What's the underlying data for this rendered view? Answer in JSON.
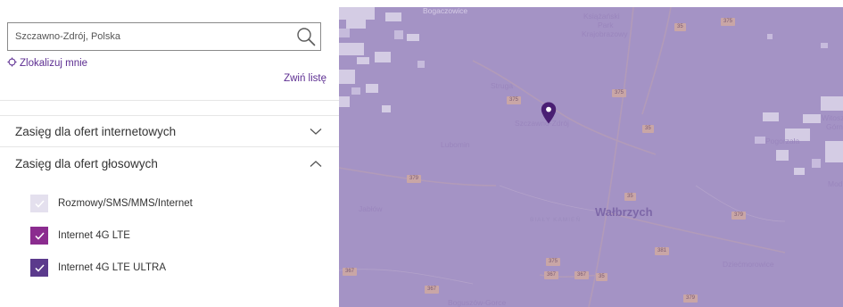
{
  "search": {
    "value": "Szczawno-Zdrój, Polska",
    "icon": "search-icon"
  },
  "locate": {
    "label": "Zlokalizuj mnie",
    "icon": "crosshair-icon"
  },
  "collapse": {
    "label": "Zwiń listę"
  },
  "accordion": {
    "internet": {
      "label": "Zasięg dla ofert internetowych",
      "icon": "chevron-down-icon"
    },
    "voice": {
      "label": "Zasięg dla ofert głosowych",
      "icon": "chevron-up-icon"
    }
  },
  "legend": [
    {
      "label": "Rozmowy/SMS/MMS/Internet",
      "color": "#e4e0ee",
      "checked": true
    },
    {
      "label": "Internet 4G LTE",
      "color": "#8b2c8f",
      "checked": true
    },
    {
      "label": "Internet 4G LTE ULTRA",
      "color": "#5b3a8c",
      "checked": true
    }
  ],
  "map": {
    "overlay_color": "#a493c5",
    "labels": {
      "bogaczowice": "Bogaczowice",
      "ksiazanski": "Książański",
      "park": "Park",
      "krajobrazowy": "Krajobrazowy",
      "struga": "Struga",
      "szczawno": "Szczawno-Zdrój",
      "lubomin": "Lubomin",
      "witoszow": "Witoszó",
      "gorny": "Górny",
      "pogorzala": "Pogorzała",
      "mod": "Mod",
      "jabtow": "Jabłów",
      "bialy_kamien": "BIAŁY KAMIEŃ",
      "walbrzych": "Wałbrzych",
      "dziecmorowice": "Dziećmorowice",
      "boguszow": "Boguszów-Gorce"
    },
    "roads": {
      "r35a": "35",
      "r375a": "375",
      "r375b": "375",
      "r35b": "35",
      "r379a": "379",
      "r35c": "35",
      "r379b": "379",
      "r381": "381",
      "r367a": "367",
      "r375c": "375",
      "r367b": "367",
      "r367c": "367",
      "r35d": "35",
      "r367d": "367",
      "r379c": "379",
      "r375d": "375"
    },
    "pin_icon": "location-pin-icon"
  }
}
